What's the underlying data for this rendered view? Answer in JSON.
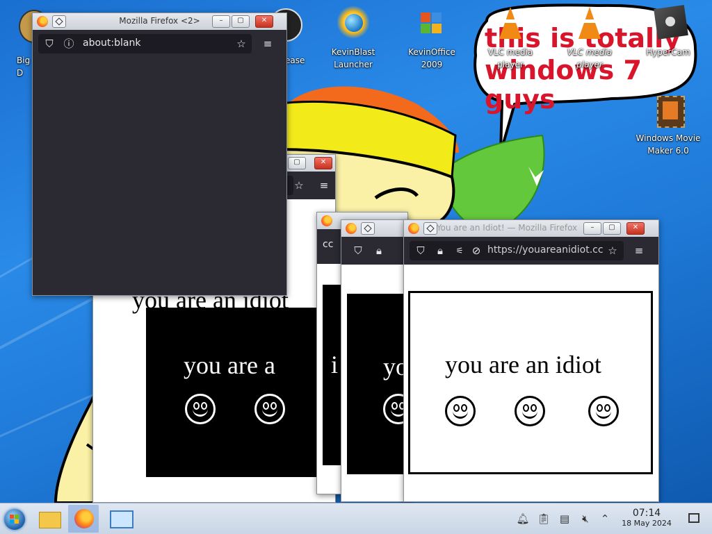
{
  "desktop": {
    "icons": [
      {
        "id": "bigd",
        "label": "Big\nD",
        "icon": "app-icon"
      },
      {
        "id": "release",
        "label": "ease",
        "icon": "app-icon"
      },
      {
        "id": "kevinblast",
        "label": "KevinBlast Launcher",
        "icon": "globe-launcher-icon"
      },
      {
        "id": "kevinoffice",
        "label": "KevinOffice 2009",
        "icon": "office-suite-icon"
      },
      {
        "id": "vlc1",
        "label": "VLC media player",
        "icon": "vlc-cone-icon"
      },
      {
        "id": "vlc2",
        "label": "VLC media player",
        "icon": "vlc-cone-icon"
      },
      {
        "id": "hypercam",
        "label": "HyperCam",
        "icon": "camera-icon"
      },
      {
        "id": "moviemaker",
        "label": "Windows Movie Maker 6.0",
        "icon": "film-strip-icon"
      }
    ],
    "wallpaper_text": [
      "this is totally",
      "windows 7 guys"
    ],
    "colors": {
      "wallpaper_blue": "#1f7ad8",
      "bubble_text": "#d8152b"
    }
  },
  "windows": {
    "firefox_blank": {
      "title": "Mozilla Firefox <2>",
      "url": "about:blank"
    },
    "idiot_front": {
      "title": "You are an Idiot! — Mozilla Firefox",
      "url": "https://youareanidiot.cc",
      "page_text": "you are an idiot"
    },
    "idiot_back": {
      "page_text": "you are an idiot",
      "page_text_partial_1": "you are a",
      "page_text_partial_2": "yo",
      "page_text_partial_3": "i"
    },
    "tab_fragment": "cc"
  },
  "taskbar": {
    "clock_time": "07:14",
    "clock_date": "18 May 2024",
    "apps": [
      {
        "id": "start",
        "icon": "windows-start-icon"
      },
      {
        "id": "files",
        "icon": "folder-icon"
      },
      {
        "id": "firefox",
        "icon": "firefox-icon",
        "active": true
      },
      {
        "id": "remote",
        "icon": "remote-desktop-icon"
      }
    ],
    "tray": [
      "notifications-icon",
      "clipboard-icon",
      "storage-icon",
      "volume-muted-icon",
      "show-hidden-chevron-icon"
    ]
  }
}
